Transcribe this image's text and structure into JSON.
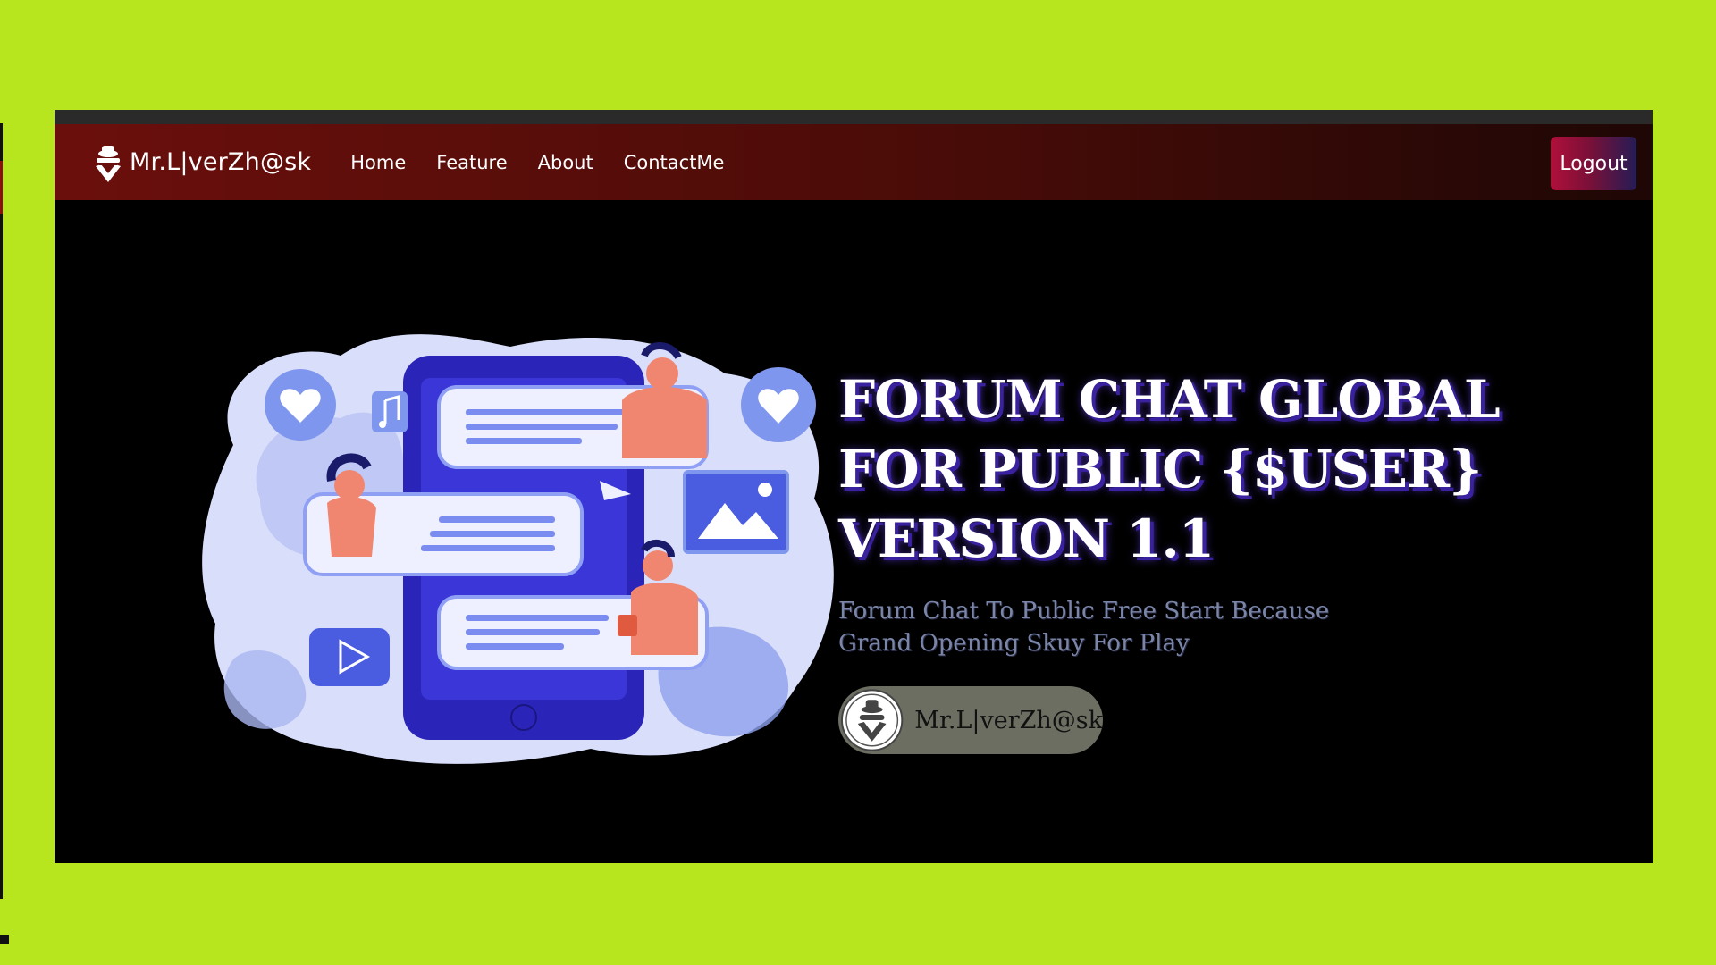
{
  "brand": {
    "name": "Mr.L|verZh@sk",
    "icon": "spy-hacker-icon"
  },
  "nav": {
    "items": [
      {
        "label": "Home"
      },
      {
        "label": "Feature"
      },
      {
        "label": "About"
      },
      {
        "label": "ContactMe"
      }
    ]
  },
  "header": {
    "logout_label": "Logout"
  },
  "hero": {
    "title_lines": [
      "FORUM CHAT GLOBAL",
      "FOR PUBLIC {$USER}",
      "VERSION 1.1"
    ],
    "subtitle_lines": [
      "Forum Chat To Public Free Start Because",
      "Grand Opening Skuy For Play"
    ],
    "author_name": "Mr.L|verZh@sk",
    "author_icon": "spy-avatar-icon",
    "illustration_icon": "chat-phone-illustration"
  },
  "colors": {
    "background": "#b7e61f",
    "navbar_start": "#6b0f0c",
    "navbar_end": "#1e0705",
    "logout_start": "#b0103a",
    "logout_end": "#251c55",
    "title_shadow": "#3a21a0",
    "subtitle": "#7a86a8",
    "pill": "#6c6e62"
  }
}
